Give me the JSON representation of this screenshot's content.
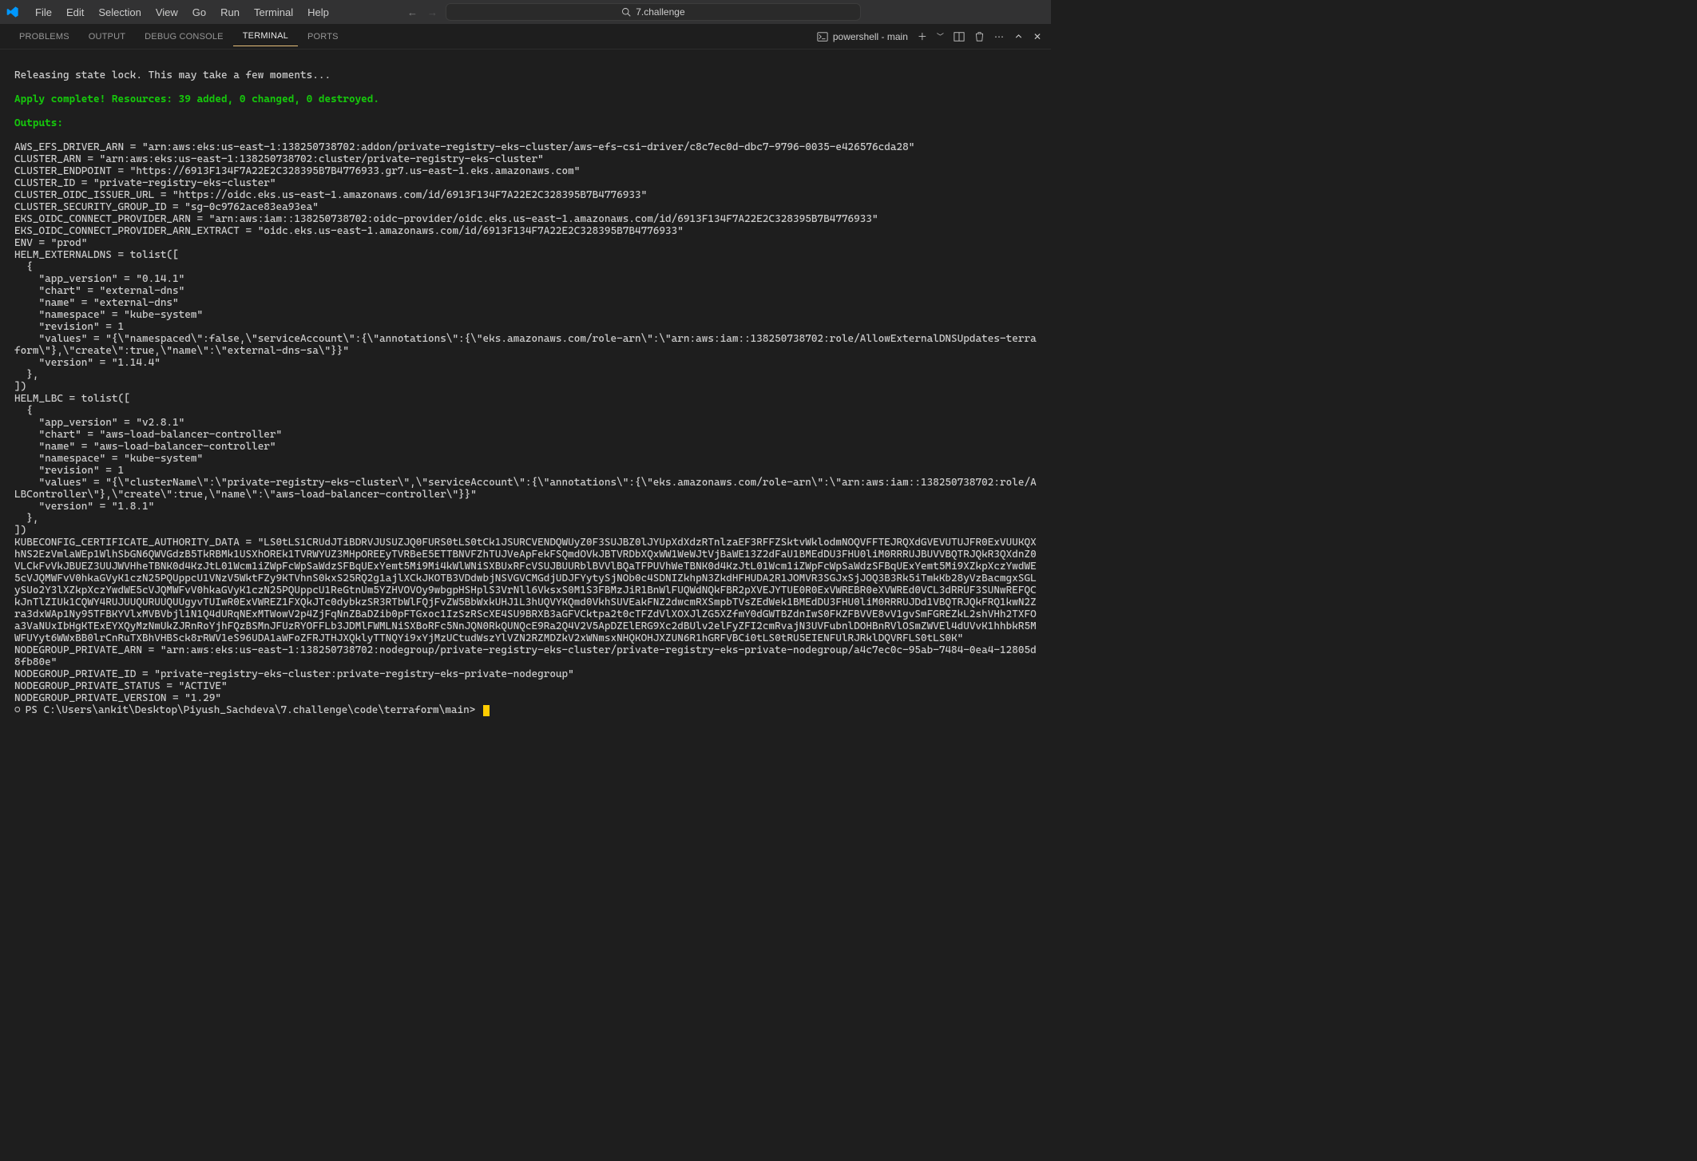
{
  "menu": [
    "File",
    "Edit",
    "Selection",
    "View",
    "Go",
    "Run",
    "Terminal",
    "Help"
  ],
  "search": {
    "value": "7.challenge"
  },
  "panel": {
    "tabs": [
      "PROBLEMS",
      "OUTPUT",
      "DEBUG CONSOLE",
      "TERMINAL",
      "PORTS"
    ],
    "active": "TERMINAL",
    "shell": "powershell - main"
  },
  "terminal": {
    "pre_line": "Releasing state lock. This may take a few moments...",
    "apply_line": "Apply complete! Resources: 39 added, 0 changed, 0 destroyed.",
    "outputs_header": "Outputs:",
    "outputs": [
      "AWS_EFS_DRIVER_ARN = \"arn:aws:eks:us-east-1:138250738702:addon/private-registry-eks-cluster/aws-efs-csi-driver/c8c7ec0d-dbc7-9796-0035-e426576cda28\"",
      "CLUSTER_ARN = \"arn:aws:eks:us-east-1:138250738702:cluster/private-registry-eks-cluster\"",
      "CLUSTER_ENDPOINT = \"https://6913F134F7A22E2C328395B7B4776933.gr7.us-east-1.eks.amazonaws.com\"",
      "CLUSTER_ID = \"private-registry-eks-cluster\"",
      "CLUSTER_OIDC_ISSUER_URL = \"https://oidc.eks.us-east-1.amazonaws.com/id/6913F134F7A22E2C328395B7B4776933\"",
      "CLUSTER_SECURITY_GROUP_ID = \"sg-0c9762ace83ea93ea\"",
      "EKS_OIDC_CONNECT_PROVIDER_ARN = \"arn:aws:iam::138250738702:oidc-provider/oidc.eks.us-east-1.amazonaws.com/id/6913F134F7A22E2C328395B7B4776933\"",
      "EKS_OIDC_CONNECT_PROVIDER_ARN_EXTRACT = \"oidc.eks.us-east-1.amazonaws.com/id/6913F134F7A22E2C328395B7B4776933\"",
      "ENV = \"prod\"",
      "HELM_EXTERNALDNS = tolist([",
      "  {",
      "    \"app_version\" = \"0.14.1\"",
      "    \"chart\" = \"external-dns\"",
      "    \"name\" = \"external-dns\"",
      "    \"namespace\" = \"kube-system\"",
      "    \"revision\" = 1",
      "    \"values\" = \"{\\\"namespaced\\\":false,\\\"serviceAccount\\\":{\\\"annotations\\\":{\\\"eks.amazonaws.com/role-arn\\\":\\\"arn:aws:iam::138250738702:role/AllowExternalDNSUpdates-terraform\\\"},\\\"create\\\":true,\\\"name\\\":\\\"external-dns-sa\\\"}}\"",
      "    \"version\" = \"1.14.4\"",
      "  },",
      "])",
      "HELM_LBC = tolist([",
      "  {",
      "    \"app_version\" = \"v2.8.1\"",
      "    \"chart\" = \"aws-load-balancer-controller\"",
      "    \"name\" = \"aws-load-balancer-controller\"",
      "    \"namespace\" = \"kube-system\"",
      "    \"revision\" = 1",
      "    \"values\" = \"{\\\"clusterName\\\":\\\"private-registry-eks-cluster\\\",\\\"serviceAccount\\\":{\\\"annotations\\\":{\\\"eks.amazonaws.com/role-arn\\\":\\\"arn:aws:iam::138250738702:role/ALBController\\\"},\\\"create\\\":true,\\\"name\\\":\\\"aws-load-balancer-controller\\\"}}\"",
      "    \"version\" = \"1.8.1\"",
      "  },",
      "])",
      "KUBECONFIG_CERTIFICATE_AUTHORITY_DATA = \"LS0tLS1CRUdJTiBDRVJUSUZJQ0FURS0tLS0tCk1JSURCVENDQWUyZ0F3SUJBZ0lJYUpXdXdzRTnlzaEF3RFFZSktvWklodmNOQVFFTEJRQXdGVEVUTUJFR0ExVUUKQXhNS2EzVmlaWEp1WlhSbGN6QWVGdzB5TkRBMk1USXhOREk1TVRWYUZ3MHpOREEyTVRBeE5ETTBNVFZhTUJVeApFekFSQmdOVkJBTVRDbXQxWW1WeWJtVjBaWE13Z2dFaU1BMEdDU3FHU0liM0RRRUJBUVVBQTRJQkR3QXdnZ0VLCkFvVkJBUEZ3UUJWVHheTBNK0d4KzJtL01Wcm1iZWpFcWpSaWdzSFBqUExYemt5Mi9Mi4kWlWNiSXBUxRFcVSUJBUURblBVVlBQaTFPUVhWeTBNK0d4KzJtL01Wcm1iZWpFcWpSaWdzSFBqUExYemt5Mi9XZkpXczYwdWE5cVJQMWFvV0hkaGVyK1czN25PQUppcU1VNzV5WktFZy9KTVhnS0kxS25RQ2g1ajlXCkJKOTB3VDdwbjNSVGVCMGdjUDJFYytySjNOb0c4SDNIZkhpN3ZkdHFHUDA2R1JOMVR3SGJxSjJOQ3B3Rk5iTmkKb28yVzBacmgxSGLySUo2Y3lXZkpXczYwdWE5cVJQMWFvV0hkaGVyK1czN25PQUppcU1ReGtnUm5YZHVOVOy9wbgpHSHplS3VrNll6VksxS0M1S3FBMzJiR1BnWlFUQWdNQkFBR2pXVEJYTUE0R0ExVWREBR0eXVWREd0VCL3dRRUF3SUNwREFQCkJnTlZIUk1CQWY4RUJUUQURUUQUUgyvTUIwR0ExVWREZ1FXQkJTc0dybkzSR3RTbWlFQjFvZW5BbWxkUHJ1L3hUQVYKQmd0VkhSUVEakFNZ2dwcmRXSmpbTVsZEdWek1BMEdDU3FHU0liM0RRRUJDd1VBQTRJQkFRQ1kwN2Zra3dxWAp1Ny95TFBKYVlxMVBVbjl1N1Q4dURqNExMTWowV2p4ZjFqNnZBaDZib0pFTGxoc1IzSzRScXE4SU9BRXB3aGFVCktpa2t0cTFZdVlXOXJlZG5XZfmY0dGWTBZdnIwS0FKZFBVVE8vV1gvSmFGREZkL2shVHh2TXFOa3VaNUxIbHgKTExEYXQyMzNmUkZJRnRoYjhFQzBSMnJFUzRYOFFLb3JDMlFWMLNiSXBoRFc5NnJQN0RkQUNQcE9Ra2Q4V2V5ApDZElERG9Xc2dBUlv2elFyZFI2cmRvajN3UVFubnlDOHBnRVlOSmZWVEl4dUVvK1hhbkR5MWFUYyt6WWxBB0lrCnRuTXBhVHBSck8rRWV1eS96UDA1aWFoZFRJTHJXQklyTTNQYi9xYjMzUCtudWszYlVZN2RZMDZkV2xWNmsxNHQKOHJXZUN6R1hGRFVBCi0tLS0tRU5EIENFUlRJRklDQVRFLS0tLS0K\"",
      "NODEGROUP_PRIVATE_ARN = \"arn:aws:eks:us-east-1:138250738702:nodegroup/private-registry-eks-cluster/private-registry-eks-private-nodegroup/a4c7ec0c-95ab-7484-0ea4-12805d8fb80e\"",
      "NODEGROUP_PRIVATE_ID = \"private-registry-eks-cluster:private-registry-eks-private-nodegroup\"",
      "NODEGROUP_PRIVATE_STATUS = \"ACTIVE\"",
      "NODEGROUP_PRIVATE_VERSION = \"1.29\""
    ],
    "prompt": "PS C:\\Users\\ankit\\Desktop\\Piyush_Sachdeva\\7.challenge\\code\\terraform\\main> "
  }
}
